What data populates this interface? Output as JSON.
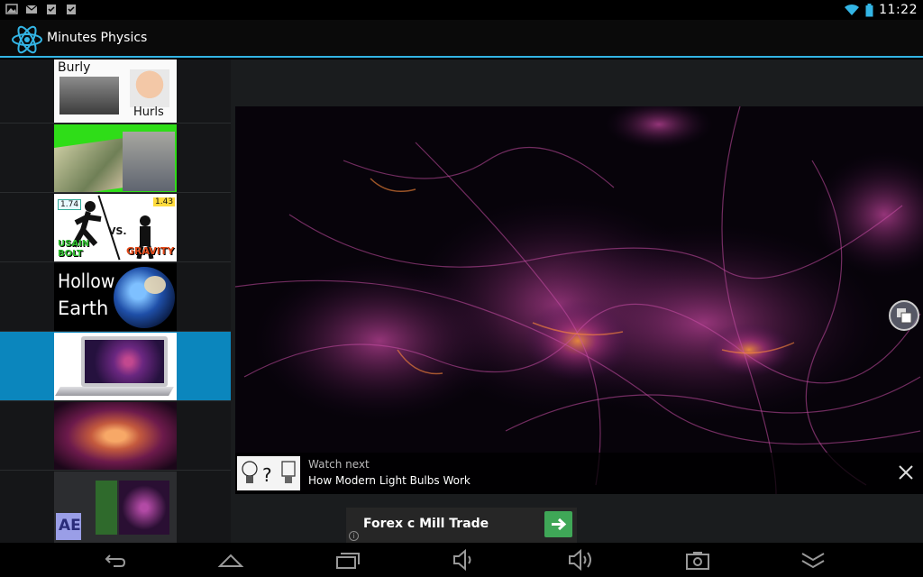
{
  "status_bar": {
    "time": "11:22",
    "left_icons": [
      "gallery-icon",
      "gmail-icon",
      "download-icon",
      "download-icon"
    ],
    "right_icons": [
      "wifi-icon",
      "battery-icon"
    ]
  },
  "action_bar": {
    "title": "Minutes Physics",
    "logo_icon": "atom-icon"
  },
  "video_list": {
    "items": [
      {
        "thumb_text_1": "Burly",
        "thumb_text_2": "Hurls",
        "selected": false
      },
      {
        "thumb_text_1": "",
        "thumb_text_2": "",
        "selected": false
      },
      {
        "thumb_text_1": "USAIN BOLT",
        "thumb_text_2": "GRAVITY",
        "thumb_badge_1": "1.74",
        "thumb_badge_2": "1.43",
        "thumb_vs": "VS.",
        "selected": false
      },
      {
        "thumb_text_1": "Hollow",
        "thumb_text_2": "Earth",
        "selected": false
      },
      {
        "thumb_text_1": "",
        "thumb_text_2": "",
        "selected": true
      },
      {
        "thumb_text_1": "",
        "thumb_text_2": "",
        "selected": false
      },
      {
        "thumb_text_1": "AE",
        "thumb_text_2": "",
        "selected": false
      }
    ]
  },
  "watch_next": {
    "label": "Watch next",
    "title": "How Modern Light Bulbs Work"
  },
  "ad": {
    "text": "Forex c Mill Trade",
    "info": "i"
  },
  "nav_bar": {
    "buttons": [
      "back-icon",
      "home-icon",
      "recent-apps-icon",
      "volume-down-icon",
      "volume-up-icon",
      "screenshot-icon",
      "menu-collapse-icon"
    ]
  },
  "colors": {
    "accent": "#33b5e5",
    "selected_row": "#0b86bd",
    "ad_button": "#3fa757"
  }
}
